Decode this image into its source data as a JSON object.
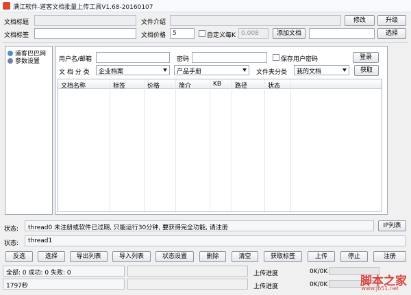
{
  "window": {
    "title": "满江软件-道客文档批量上传工具V1.68-20160107"
  },
  "top": {
    "doc_title_label": "文档标题",
    "doc_title_value": "",
    "file_desc_label": "文件介绍",
    "file_desc_value": "",
    "modify_label": "修改",
    "upgrade_label": "升级",
    "doc_tag_label": "文档标签",
    "doc_tag_value": "",
    "doc_price_label": "文档价格",
    "doc_price_value": "5",
    "custom_per_k_label": "自定义每K",
    "custom_per_k_value": "0.008",
    "add_doc_label": "添加文档",
    "select_path_value": "",
    "select_label": "选择"
  },
  "tree": {
    "items": [
      {
        "label": "道客巴巴网"
      },
      {
        "label": "参数设置"
      }
    ]
  },
  "login": {
    "user_label": "用户名/邮箱",
    "user_value": "",
    "pwd_label": "密码",
    "pwd_value": "",
    "save_pwd_label": "保存用户密码",
    "login_label": "登录"
  },
  "category": {
    "label": "文 档 分 类",
    "select1": "企业档案",
    "select2": "产品手册",
    "folder_label": "文件夹分类",
    "folder_value": "我的文档",
    "fetch_label": "获取"
  },
  "table": {
    "columns": [
      "文档名称",
      "标签",
      "价格",
      "简介",
      "KB",
      "路径",
      "状态"
    ],
    "rows": []
  },
  "status1": {
    "label": "状态:",
    "text": "thread0 未注册或软件已过期, 只能运行30分钟, 要获得完全功能, 请注册",
    "ip_list_label": "IP列表"
  },
  "status2": {
    "label": "状态:",
    "text": "thread1"
  },
  "actions": [
    {
      "label": "反选"
    },
    {
      "label": "选择"
    },
    {
      "label": "导出列表"
    },
    {
      "label": "导入列表"
    },
    {
      "label": "状态设置"
    },
    {
      "label": "删除"
    },
    {
      "label": "清空"
    },
    {
      "label": "获取标签"
    },
    {
      "label": "上传"
    },
    {
      "label": "停止"
    },
    {
      "label": "注册"
    }
  ],
  "footer": {
    "summary": "全部: 0 成功: 0 失败: 0",
    "elapsed": "1797秒",
    "upload_progress_label": "上传进度",
    "progress1_text": "0K/0K",
    "progress1_value": 0,
    "upload_progress_label2": "上传进度",
    "progress2_text": "0K/0K",
    "progress2_value": 0
  },
  "watermark": {
    "text": "脚本之家",
    "url": "www.jb51.net"
  },
  "colors": {
    "watermark": "#d7443d",
    "border": "#9ca6b4"
  }
}
